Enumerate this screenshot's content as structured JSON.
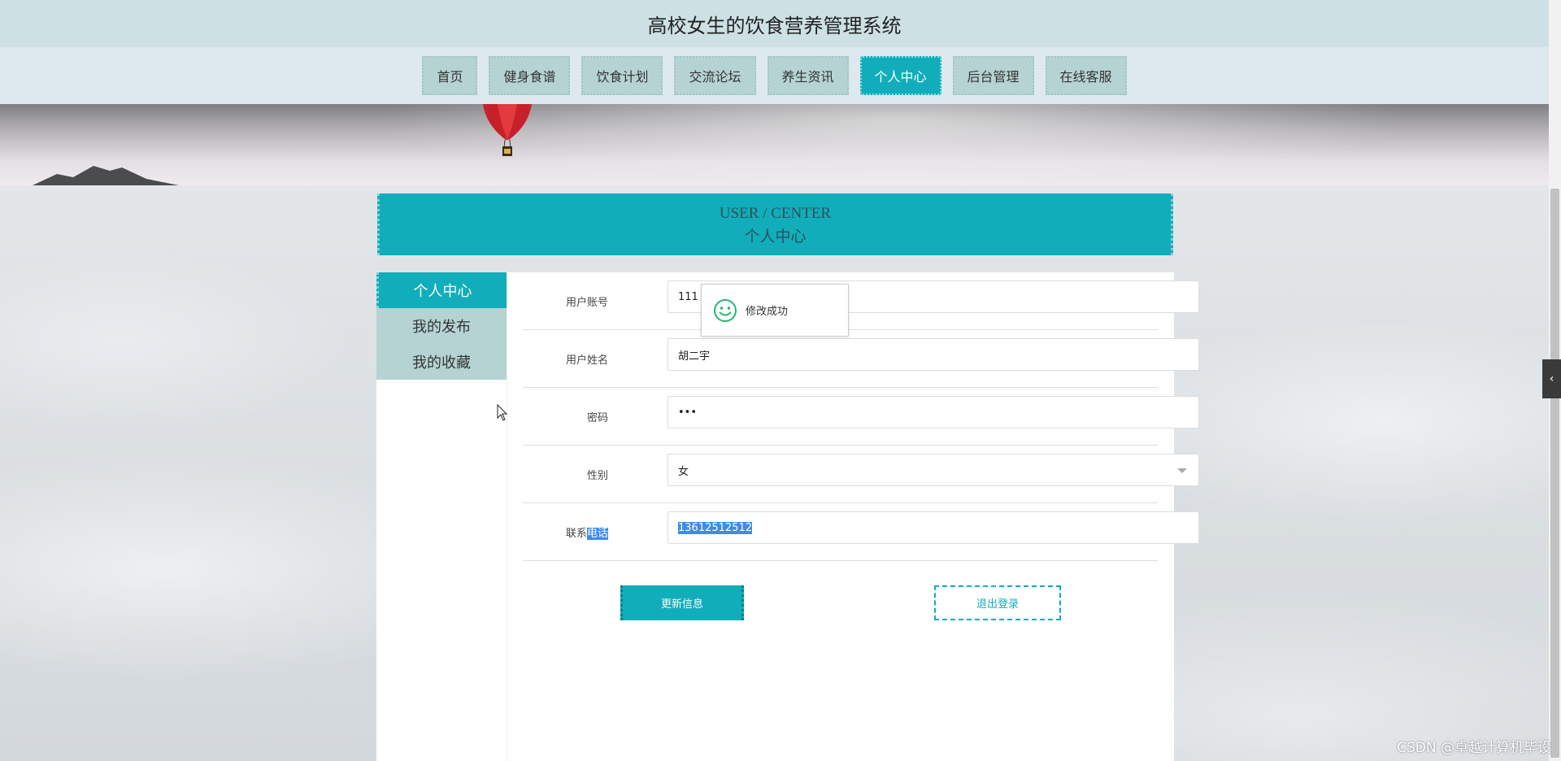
{
  "header": {
    "title": "高校女生的饮食营养管理系统"
  },
  "nav": {
    "items": [
      {
        "label": "首页",
        "active": false
      },
      {
        "label": "健身食谱",
        "active": false
      },
      {
        "label": "饮食计划",
        "active": false
      },
      {
        "label": "交流论坛",
        "active": false
      },
      {
        "label": "养生资讯",
        "active": false
      },
      {
        "label": "个人中心",
        "active": true
      },
      {
        "label": "后台管理",
        "active": false
      },
      {
        "label": "在线客服",
        "active": false
      }
    ]
  },
  "section": {
    "title_en": "USER / CENTER",
    "title_cn": "个人中心"
  },
  "sidebar": {
    "items": [
      {
        "label": "个人中心",
        "active": true
      },
      {
        "label": "我的发布",
        "active": false
      },
      {
        "label": "我的收藏",
        "active": false
      }
    ]
  },
  "form": {
    "username": {
      "label": "用户账号",
      "value": "111"
    },
    "name": {
      "label": "用户姓名",
      "value": "胡二宇"
    },
    "password": {
      "label": "密码",
      "value": "•••"
    },
    "gender": {
      "label": "性别",
      "value": "女"
    },
    "phone": {
      "label_prefix": "联系",
      "label_highlight": "电话",
      "value": "13612512512"
    }
  },
  "buttons": {
    "update": "更新信息",
    "logout": "退出登录"
  },
  "toast": {
    "message": "修改成功"
  },
  "watermark": "CSDN @卓越计算机毕设",
  "colors": {
    "accent": "#12adba",
    "nav_bg": "#b6d3d3",
    "header_bg": "#cde1e4"
  }
}
